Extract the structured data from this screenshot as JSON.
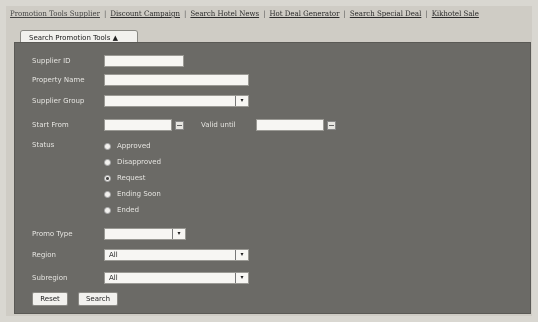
{
  "topnav": {
    "items": [
      "Promotion Tools Supplier",
      "Discount Campaign",
      "Search Hotel News",
      "Hot Deal Generator",
      "Search Special Deal",
      "Kikhotel Sale"
    ],
    "separator": "|"
  },
  "tab": {
    "label": "Search Promotion Tools ▲"
  },
  "form": {
    "supplier_id": {
      "label": "Supplier ID",
      "value": ""
    },
    "property_name": {
      "label": "Property Name",
      "value": ""
    },
    "supplier_group": {
      "label": "Supplier Group",
      "value": ""
    },
    "start_from": {
      "label": "Start From",
      "value": ""
    },
    "valid_until": {
      "label": "Valid until",
      "value": ""
    },
    "status": {
      "label": "Status",
      "options": [
        "Approved",
        "Disapproved",
        "Request",
        "Ending Soon",
        "Ended"
      ],
      "selected": "Request"
    },
    "promo_type": {
      "label": "Promo Type",
      "value": ""
    },
    "region": {
      "label": "Region",
      "value": "All"
    },
    "subregion": {
      "label": "Subregion",
      "value": "All"
    }
  },
  "buttons": {
    "reset": "Reset",
    "search": "Search"
  },
  "icons": {
    "dropdown": "▾",
    "calendar": "calendar-icon"
  }
}
